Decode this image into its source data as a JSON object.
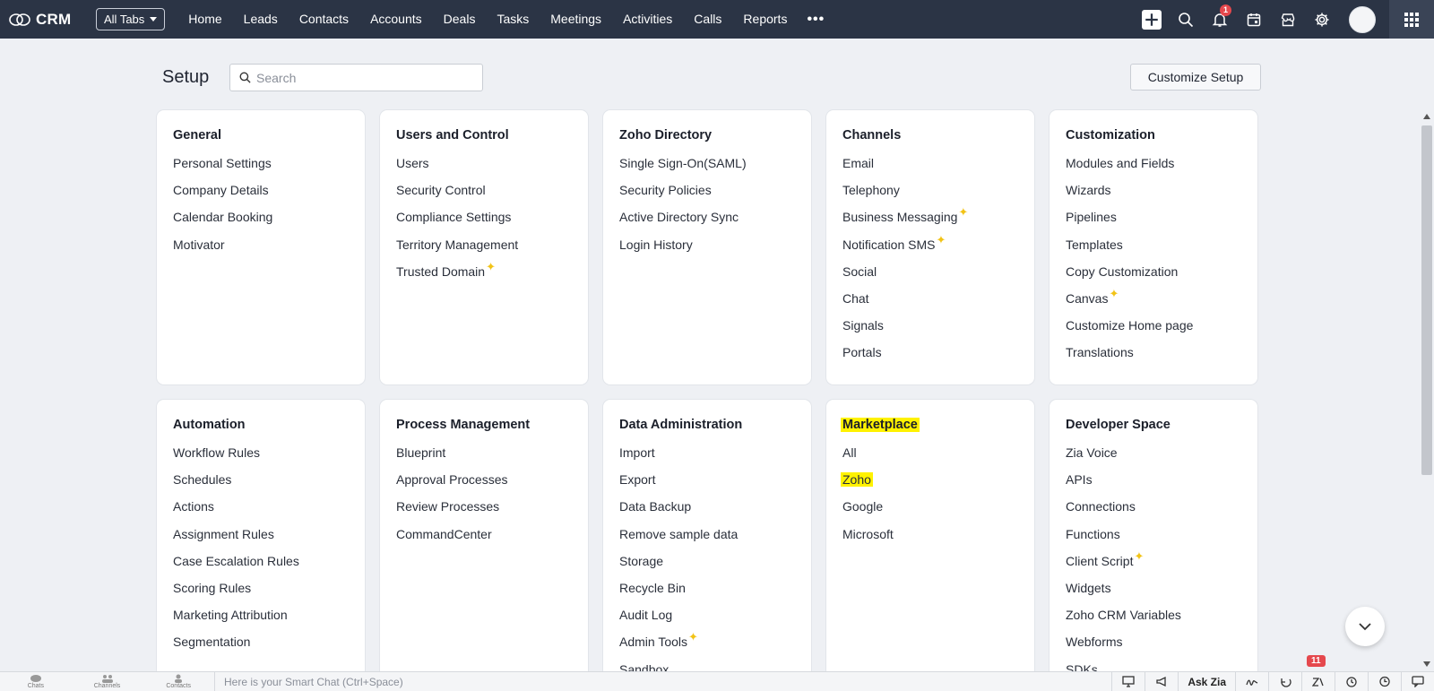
{
  "topbar": {
    "brand": "CRM",
    "all_tabs": "All Tabs",
    "tabs": [
      "Home",
      "Leads",
      "Contacts",
      "Accounts",
      "Deals",
      "Tasks",
      "Meetings",
      "Activities",
      "Calls",
      "Reports"
    ],
    "more": "•••",
    "notification_count": "1"
  },
  "setup": {
    "title": "Setup",
    "search_placeholder": "Search",
    "customize_button": "Customize Setup"
  },
  "cards": [
    {
      "title": "General",
      "items": [
        "Personal Settings",
        "Company Details",
        "Calendar Booking",
        "Motivator"
      ]
    },
    {
      "title": "Users and Control",
      "items": [
        "Users",
        "Security Control",
        "Compliance Settings",
        "Territory Management",
        "Trusted Domain"
      ]
    },
    {
      "title": "Zoho Directory",
      "items": [
        "Single Sign-On(SAML)",
        "Security Policies",
        "Active Directory Sync",
        "Login History"
      ]
    },
    {
      "title": "Channels",
      "items": [
        "Email",
        "Telephony",
        "Business Messaging",
        "Notification SMS",
        "Social",
        "Chat",
        "Signals",
        "Portals"
      ]
    },
    {
      "title": "Customization",
      "items": [
        "Modules and Fields",
        "Wizards",
        "Pipelines",
        "Templates",
        "Copy Customization",
        "Canvas",
        "Customize Home page",
        "Translations"
      ]
    },
    {
      "title": "Automation",
      "items": [
        "Workflow Rules",
        "Schedules",
        "Actions",
        "Assignment Rules",
        "Case Escalation Rules",
        "Scoring Rules",
        "Marketing Attribution",
        "Segmentation"
      ]
    },
    {
      "title": "Process Management",
      "items": [
        "Blueprint",
        "Approval Processes",
        "Review Processes",
        "CommandCenter"
      ]
    },
    {
      "title": "Data Administration",
      "items": [
        "Import",
        "Export",
        "Data Backup",
        "Remove sample data",
        "Storage",
        "Recycle Bin",
        "Audit Log",
        "Admin Tools",
        "Sandbox"
      ]
    },
    {
      "title": "Marketplace",
      "items": [
        "All",
        "Zoho",
        "Google",
        "Microsoft"
      ]
    },
    {
      "title": "Developer Space",
      "items": [
        "Zia Voice",
        "APIs",
        "Connections",
        "Functions",
        "Client Script",
        "Widgets",
        "Zoho CRM Variables",
        "Webforms",
        "SDKs"
      ]
    }
  ],
  "bottombar": {
    "chats": "Chats",
    "channels": "Channels",
    "contacts": "Contacts",
    "smart_chat_placeholder": "Here is your Smart Chat (Ctrl+Space)",
    "ask_zia": "Ask Zia",
    "zia_badge": "11"
  },
  "colors": {
    "topbar": "#2b3445",
    "highlight": "#fff200",
    "sparkle": "#f2c316",
    "badge": "#e5484d"
  }
}
